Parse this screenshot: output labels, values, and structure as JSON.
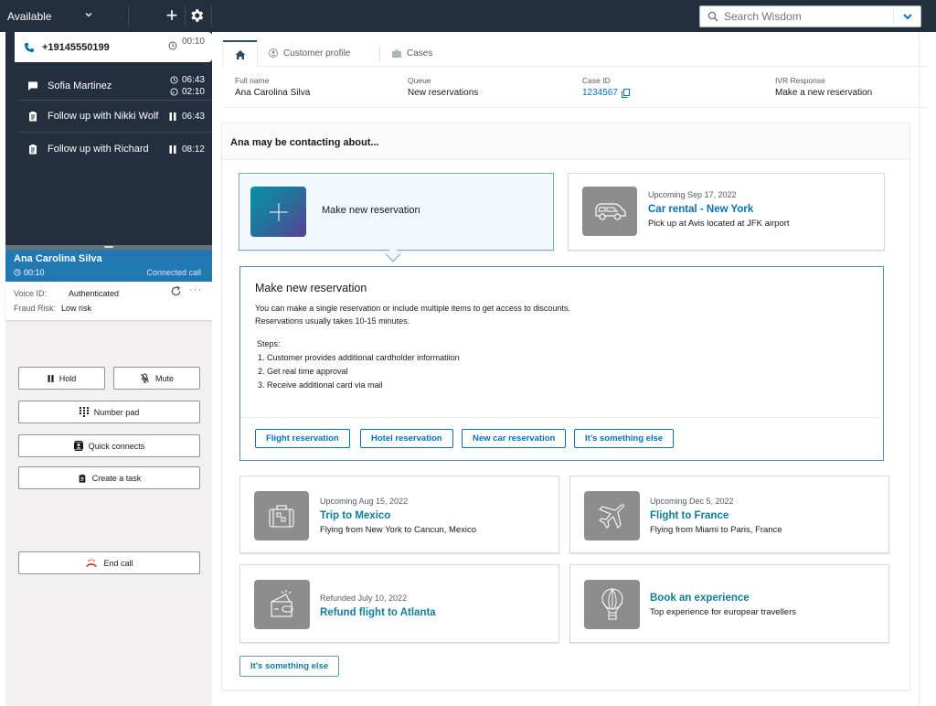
{
  "topbar": {
    "status": "Available",
    "add_icon": "plus-icon",
    "settings_icon": "gear-icon",
    "search": {
      "placeholder": "Search Wisdom",
      "value": ""
    }
  },
  "contacts": [
    {
      "icon": "phone-icon",
      "name": "+19145550199",
      "time": "00:10",
      "time_icon": "clock-icon",
      "active": true
    },
    {
      "icon": "chat-icon",
      "name": "Sofia Martinez",
      "time": "06:43",
      "time2": "02:10"
    },
    {
      "icon": "task-icon",
      "name": "Follow up with Nikki Wolf",
      "time": "06:43",
      "time_icon": "pause-icon"
    },
    {
      "icon": "task-icon",
      "name": "Follow up with Richard",
      "time": "08:12",
      "time_icon": "pause-icon"
    }
  ],
  "call": {
    "name": "Ana Carolina Silva",
    "duration": "00:10",
    "status": "Connected call",
    "voice_id_label": "Voice ID:",
    "voice_id_value": "Authenticated",
    "fraud_label": "Fraud Risk:",
    "fraud_value": "Low risk"
  },
  "controls": {
    "hold": "Hold",
    "mute": "Mute",
    "number_pad": "Number pad",
    "quick_connects": "Quick connects",
    "create_task": "Create a task",
    "end_call": "End call"
  },
  "tabs": [
    {
      "label": "Home",
      "icon": "home-icon",
      "active": true
    },
    {
      "label": "Customer profile",
      "icon": "user-icon"
    },
    {
      "label": "Cases",
      "icon": "briefcase-icon"
    }
  ],
  "info": {
    "full_name_label": "Full name",
    "full_name": "Ana Carolina Silva",
    "queue_label": "Queue",
    "queue": "New reservations",
    "case_id_label": "Case ID",
    "case_id": "1234567",
    "ivr_label": "IVR Response",
    "ivr": "Make a new reservation"
  },
  "panel": {
    "title": "Ana may be contacting about...",
    "selected_card": {
      "title": "Make new reservation"
    },
    "cards": [
      {
        "pre": "Upcoming Sep 17, 2022",
        "title": "Car rental - New York",
        "desc": "Pick up at Avis located at JFK airport",
        "icon": "car-icon"
      },
      {
        "pre": "Upcoming Aug 15, 2022",
        "title": "Trip to Mexico",
        "desc": "Flying from New York to Cancun, Mexico",
        "icon": "suitcase-icon"
      },
      {
        "pre": "Upcoming Dec 5, 2022",
        "title": "Flight to France",
        "desc": "Flying from Miami to Paris, France",
        "icon": "airplane-icon"
      },
      {
        "pre": "Refunded July 10, 2022",
        "title": "Refund flight to Atlanta",
        "desc": "",
        "icon": "wallet-icon"
      },
      {
        "pre": "",
        "title": "Book an experience",
        "desc": "Top experience for europear travellers",
        "icon": "balloon-icon"
      }
    ],
    "detail": {
      "title": "Make new reservation",
      "line1": "You can make a single reservation or include multiple items to get access to discounts.",
      "line2": "Reservations usually takes 10-15 minutes.",
      "steps_label": "Steps:",
      "steps": [
        "1. Customer provides additional cardholder informatiion",
        "2. Get real time approval",
        "3. Receive additional card via mail"
      ],
      "buttons": [
        "Flight reservation",
        "Hotel reservation",
        "New car reservation",
        "It’s something else"
      ]
    },
    "else_button": "It's something else"
  }
}
